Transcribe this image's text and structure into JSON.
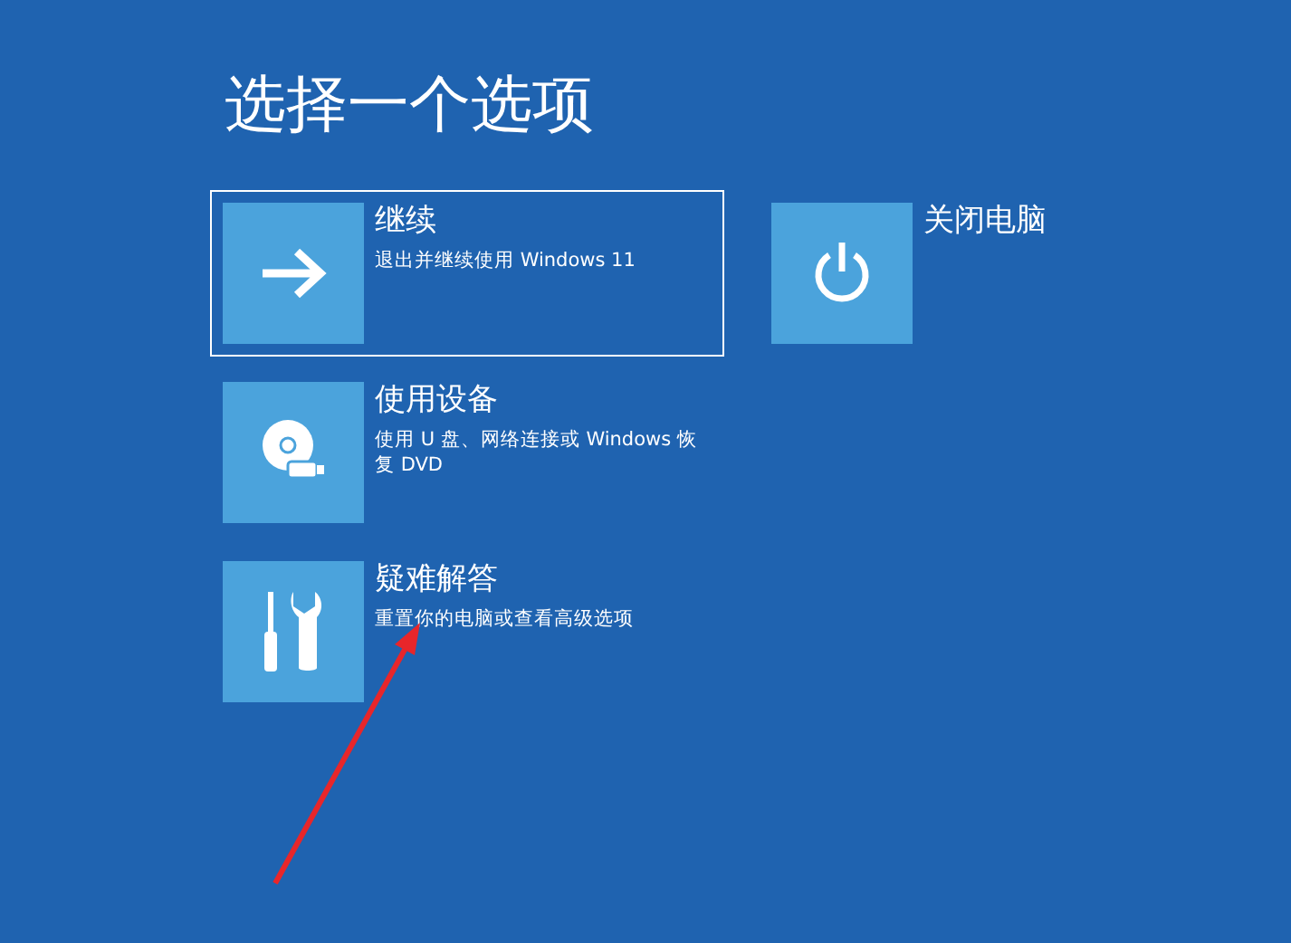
{
  "title": "选择一个选项",
  "options": [
    {
      "kind": "continue",
      "label": "继续",
      "description": "退出并继续使用 Windows 11",
      "selected": true
    },
    {
      "kind": "device",
      "label": "使用设备",
      "description": "使用 U 盘、网络连接或 Windows 恢复 DVD",
      "selected": false
    },
    {
      "kind": "troubleshoot",
      "label": "疑难解答",
      "description": "重置你的电脑或查看高级选项",
      "selected": false
    },
    {
      "kind": "shutdown",
      "label": "关闭电脑",
      "selected": false
    }
  ]
}
